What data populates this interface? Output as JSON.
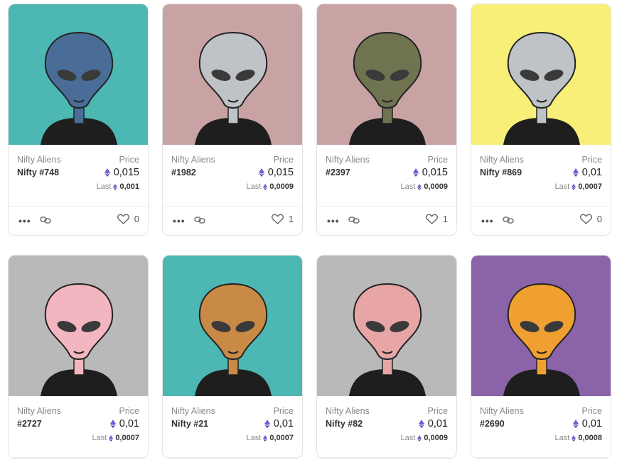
{
  "icons": {
    "menu": "ellipsis-icon",
    "link": "link-icon",
    "like": "heart-icon",
    "currency": "ethereum-icon"
  },
  "accent_color": "#7b5cd6",
  "cards": [
    {
      "collection": "Nifty Aliens",
      "name": "Nifty #748",
      "price_label": "Price",
      "price": "0,015",
      "last_label": "Last",
      "last": "0,001",
      "likes": "0",
      "bg": "#4cb7b3",
      "skin": "#4a6d98"
    },
    {
      "collection": "Nifty Aliens",
      "name": "#1982",
      "price_label": "Price",
      "price": "0,015",
      "last_label": "Last",
      "last": "0,0009",
      "likes": "1",
      "bg": "#c9a3a3",
      "skin": "#bfc2c6"
    },
    {
      "collection": "Nifty Aliens",
      "name": "#2397",
      "price_label": "Price",
      "price": "0,015",
      "last_label": "Last",
      "last": "0,0009",
      "likes": "1",
      "bg": "#c9a3a3",
      "skin": "#6f7350"
    },
    {
      "collection": "Nifty Aliens",
      "name": "Nifty #869",
      "price_label": "Price",
      "price": "0,01",
      "last_label": "Last",
      "last": "0,0007",
      "likes": "0",
      "bg": "#f7ef78",
      "skin": "#bfc2c6"
    },
    {
      "collection": "Nifty Aliens",
      "name": "#2727",
      "price_label": "Price",
      "price": "0,01",
      "last_label": "Last",
      "last": "0,0007",
      "likes": "",
      "bg": "#b9b9b9",
      "skin": "#f3b6c0"
    },
    {
      "collection": "Nifty Aliens",
      "name": "Nifty #21",
      "price_label": "Price",
      "price": "0,01",
      "last_label": "Last",
      "last": "0,0007",
      "likes": "",
      "bg": "#4cb7b3",
      "skin": "#c98a45"
    },
    {
      "collection": "Nifty Aliens",
      "name": "Nifty #82",
      "price_label": "Price",
      "price": "0,01",
      "last_label": "Last",
      "last": "0,0009",
      "likes": "",
      "bg": "#b9b9b9",
      "skin": "#e7a5a5"
    },
    {
      "collection": "Nifty Aliens",
      "name": "#2690",
      "price_label": "Price",
      "price": "0,01",
      "last_label": "Last",
      "last": "0,0008",
      "likes": "",
      "bg": "#8a63a8",
      "skin": "#f0a030"
    }
  ]
}
